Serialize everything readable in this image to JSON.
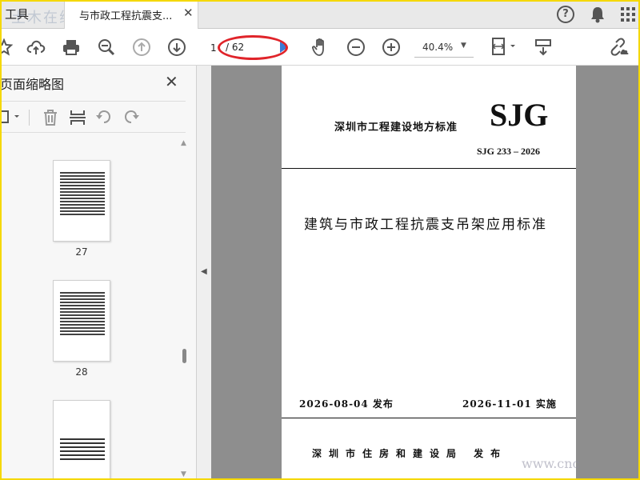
{
  "tabbar": {
    "tools_label": "工具",
    "doc_tab_title": "与市政工程抗震支...",
    "close_glyph": "✕",
    "help_glyph": "?",
    "watermark": "土木在线网"
  },
  "toolbar": {
    "page_current": "1",
    "page_total": "/ 62",
    "zoom": "40.4%",
    "zoom_caret": "▼"
  },
  "left_panel": {
    "title": "页面缩略图",
    "close_glyph": "✕",
    "thumbnails": [
      {
        "page": "27"
      },
      {
        "page": "28"
      },
      {
        "page": ""
      }
    ],
    "scroll_up": "▲",
    "scroll_down": "▼"
  },
  "collapse_glyph": "◀",
  "document": {
    "org": "深圳市工程建设地方标准",
    "logo": "SJG",
    "code": "SJG 233 – 2026",
    "title": "建筑与市政工程抗震支吊架应用标准",
    "issue_date": "2026-08-04  发布",
    "impl_date": "2026-11-01  实施",
    "publisher": "深圳市住房和建设局  发布"
  },
  "watermark_bottom": "www.cnc",
  "colors": {
    "highlight_border": "#f5d800",
    "annotation_red": "#e0242a"
  }
}
